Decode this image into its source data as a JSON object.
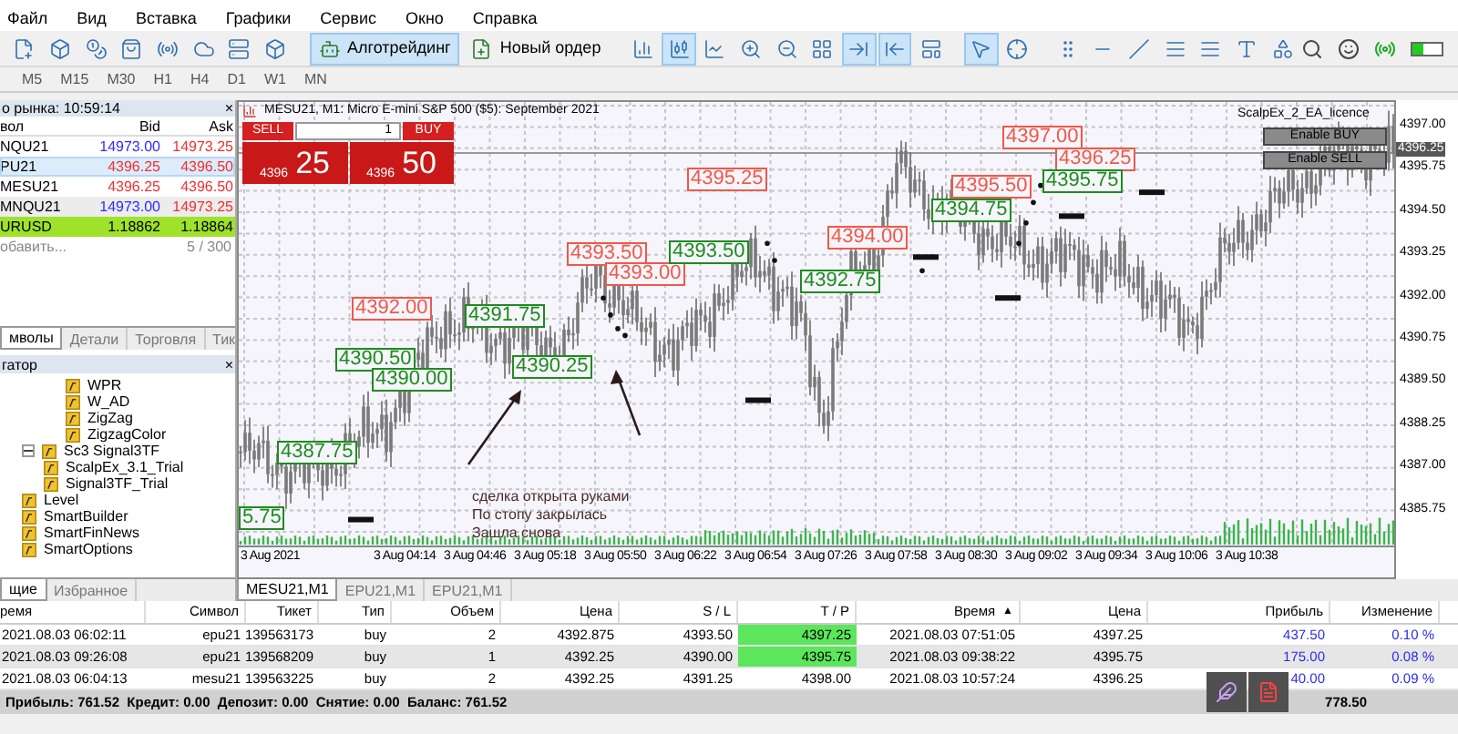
{
  "menu": [
    "Файл",
    "Вид",
    "Вставка",
    "Графики",
    "Сервис",
    "Окно",
    "Справка"
  ],
  "toolbar": [
    {
      "selected": false
    },
    {
      "selected": false
    },
    {
      "selected": false
    },
    {
      "selected": false
    },
    {
      "selected": false
    },
    {
      "selected": false
    },
    {
      "selected": false
    },
    {
      "selected": false
    },
    {
      "label": "Алготрейдинг",
      "selected": true
    },
    {
      "label": "Новый ордер",
      "selected": false
    },
    {
      "selected": false
    },
    {
      "selected": true
    },
    {
      "selected": false
    },
    {
      "selected": false
    },
    {
      "selected": false
    },
    {
      "selected": false
    },
    {
      "selected": true
    },
    {
      "selected": true
    },
    {
      "selected": false
    },
    {
      "selected": true
    },
    {
      "selected": false
    },
    {
      "selected": false
    },
    {
      "selected": false
    },
    {
      "selected": false
    },
    {
      "selected": false
    },
    {
      "selected": false
    },
    {
      "selected": false
    },
    {
      "selected": false
    }
  ],
  "timeframes": [
    "M5",
    "M15",
    "M30",
    "H1",
    "H4",
    "D1",
    "W1",
    "MN"
  ],
  "market_watch": {
    "title": "о рынка: 10:59:14",
    "close": "×",
    "columns": [
      "вол",
      "Bid",
      "Ask"
    ],
    "rows": [
      {
        "symbol": "NQU21",
        "bid": {
          "text": "14973.00",
          "color": "#2b2bff"
        },
        "ask": {
          "text": "14973.25",
          "color": "#f03030"
        },
        "selected": false,
        "highlight": false
      },
      {
        "symbol": "PU21",
        "bid": {
          "text": "4396.25",
          "color": "#f03030"
        },
        "ask": {
          "text": "4396.50",
          "color": "#f03030"
        },
        "selected": true,
        "highlight": false
      },
      {
        "symbol": "MESU21",
        "bid": {
          "text": "4396.25",
          "color": "#f03030"
        },
        "ask": {
          "text": "4396.50",
          "color": "#f03030"
        },
        "selected": false,
        "highlight": false
      },
      {
        "symbol": "MNQU21",
        "bid": {
          "text": "14973.00",
          "color": "#2b2bff"
        },
        "ask": {
          "text": "14973.25",
          "color": "#f03030"
        },
        "selected": false,
        "highlight": false
      },
      {
        "symbol": "URUSD",
        "bid": {
          "text": "1.18862"
        },
        "ask": {
          "text": "1.18864"
        },
        "selected": false,
        "highlight": true
      }
    ],
    "add": "обавить...",
    "count": "5 / 300",
    "tabs": [
      {
        "label": "мволы",
        "selected": true
      },
      {
        "label": "Детали",
        "selected": false
      },
      {
        "label": "Торговля",
        "selected": false
      },
      {
        "label": "Тик",
        "selected": false
      }
    ]
  },
  "navigator": {
    "title": "гатор",
    "close": "×",
    "tree": [
      {
        "children": [
          {
            "label": "WPR"
          },
          {
            "label": "W_AD"
          },
          {
            "label": "ZigZag"
          },
          {
            "label": "ZigzagColor"
          }
        ]
      },
      {
        "label": "Sc3 Signal3TF",
        "expanded": true,
        "children": [
          {
            "label": "ScalpEx_3.1_Trial"
          },
          {
            "label": "Signal3TF_Trial"
          }
        ]
      },
      {
        "label": "Level"
      },
      {
        "label": "SmartBuilder"
      },
      {
        "label": "SmartFinNews"
      },
      {
        "label": "SmartOptions"
      }
    ],
    "tabs": [
      {
        "label": "щие",
        "selected": true
      },
      {
        "label": "Избранное",
        "selected": false
      }
    ]
  },
  "chart": {
    "title": "MESU21, M1:  Micro E-mini S&P 500 ($5): September 2021",
    "one_click": {
      "sell": "SELL",
      "buy": "BUY",
      "volume": "1",
      "sell_big": "4396",
      "sell_small": "25",
      "buy_big": "4396",
      "buy_small": "50"
    },
    "expert": "ScalpEx_2_EA_licence",
    "buttons": [
      "Enable BUY",
      "Enable SELL"
    ],
    "trade_labels": [
      {
        "text": "4397.00",
        "color": "#f0584a"
      },
      {
        "text": "4396.25",
        "color": "#f0584a"
      },
      {
        "text": "4395.50",
        "color": "#f0584a"
      },
      {
        "text": "4395.75",
        "color": "#1e8c1e"
      },
      {
        "text": "4394.75",
        "color": "#1e8c1e"
      },
      {
        "text": "4395.25",
        "color": "#f0584a"
      },
      {
        "text": "4394.00",
        "color": "#f0584a"
      },
      {
        "text": "4393.50",
        "color": "#f0584a"
      },
      {
        "text": "4393.00",
        "color": "#f0584a"
      },
      {
        "text": "4393.50",
        "color": "#1e8c1e"
      },
      {
        "text": "4392.75",
        "color": "#1e8c1e"
      },
      {
        "text": "4392.00",
        "color": "#f0584a"
      },
      {
        "text": "4391.75",
        "color": "#1e8c1e"
      },
      {
        "text": "4390.50",
        "color": "#1e8c1e"
      },
      {
        "text": "4390.00",
        "color": "#1e8c1e"
      },
      {
        "text": "4390.25",
        "color": "#1e8c1e"
      },
      {
        "text": "4387.75",
        "color": "#1e8c1e"
      },
      {
        "text": "5.75",
        "color": "#1e8c1e"
      }
    ],
    "annotation": [
      "сделка открыта руками",
      "По стопу закрылась",
      "Зашла снова"
    ],
    "price_axis": [
      "4397.00",
      "4395.75",
      "4394.50",
      "4393.25",
      "4392.00",
      "4390.75",
      "4389.50",
      "4388.25",
      "4387.00",
      "4385.75"
    ],
    "current_price": "4396.25",
    "time_axis": [
      "3 Aug 2021",
      "3 Aug 04:14",
      "3 Aug 04:46",
      "3 Aug 05:18",
      "3 Aug 05:50",
      "3 Aug 06:22",
      "3 Aug 06:54",
      "3 Aug 07:26",
      "3 Aug 07:58",
      "3 Aug 08:30",
      "3 Aug 09:02",
      "3 Aug 09:34",
      "3 Aug 10:06",
      "3 Aug 10:38"
    ],
    "tabs": [
      {
        "label": "MESU21,M1",
        "selected": true
      },
      {
        "label": "EPU21,M1",
        "selected": false
      },
      {
        "label": "EPU21,M1",
        "selected": false
      }
    ]
  },
  "trades": {
    "columns": [
      "ремя",
      "Символ",
      "Тикет",
      "Тип",
      "Объем",
      "Цена",
      "S / L",
      "T / P",
      "Время",
      "Цена",
      "Прибыль",
      "Изменение"
    ],
    "sort_arrow": "▲",
    "rows": [
      {
        "cells": [
          "2021.08.03 06:02:11",
          "epu21",
          "139563173",
          "buy",
          "2",
          "4392.875",
          "4393.50",
          "4397.25",
          "2021.08.03 07:51:05",
          "4397.25",
          "437.50",
          "0.10 %"
        ],
        "tp_hit": true,
        "selected": false
      },
      {
        "cells": [
          "2021.08.03 09:26:08",
          "epu21",
          "139568209",
          "buy",
          "1",
          "4392.25",
          "4390.00",
          "4395.75",
          "2021.08.03 09:38:22",
          "4395.75",
          "175.00",
          "0.08 %"
        ],
        "tp_hit": true,
        "selected": true
      },
      {
        "cells": [
          "2021.08.03 06:04:13",
          "mesu21",
          "139563225",
          "buy",
          "2",
          "4392.25",
          "4391.25",
          "4398.00",
          "2021.08.03 10:57:24",
          "4396.25",
          "40.00",
          "0.09 %"
        ],
        "tp_hit": false,
        "selected": false
      }
    ],
    "summary": "Прибыль: 761.52  Кредит: 0.00  Депозит: 0.00  Снятие: 0.00  Баланс: 761.52",
    "total": "778.50"
  }
}
